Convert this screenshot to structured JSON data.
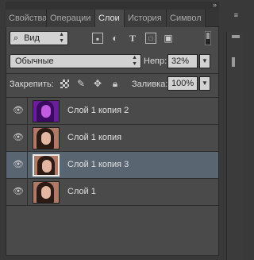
{
  "tabs": [
    {
      "label": "Свойства",
      "active": false
    },
    {
      "label": "Операции",
      "active": false
    },
    {
      "label": "Слои",
      "active": true
    },
    {
      "label": "История",
      "active": false
    },
    {
      "label": "Символ",
      "active": false
    }
  ],
  "filter": {
    "kind_label": "Вид",
    "icons": [
      "image-filter-icon",
      "adjustment-filter-icon",
      "type-filter-icon",
      "shape-filter-icon",
      "smart-object-filter-icon"
    ]
  },
  "blend": {
    "mode": "Обычные",
    "opacity_label": "Непр:",
    "opacity_value": "32%"
  },
  "lock": {
    "label": "Закрепить:",
    "fill_label": "Заливка:",
    "fill_value": "100%"
  },
  "layers": [
    {
      "name": "Слой 1 копия 2",
      "visible": true,
      "selected": false,
      "thumb": "violet"
    },
    {
      "name": "Слой 1 копия",
      "visible": true,
      "selected": false,
      "thumb": "portrait"
    },
    {
      "name": "Слой 1 копия 3",
      "visible": true,
      "selected": true,
      "thumb": "portrait"
    },
    {
      "name": "Слой 1",
      "visible": true,
      "selected": false,
      "thumb": "portrait"
    }
  ],
  "colors": {
    "selected_row": "#5a6572",
    "panel_bg": "#4a4a4a"
  }
}
